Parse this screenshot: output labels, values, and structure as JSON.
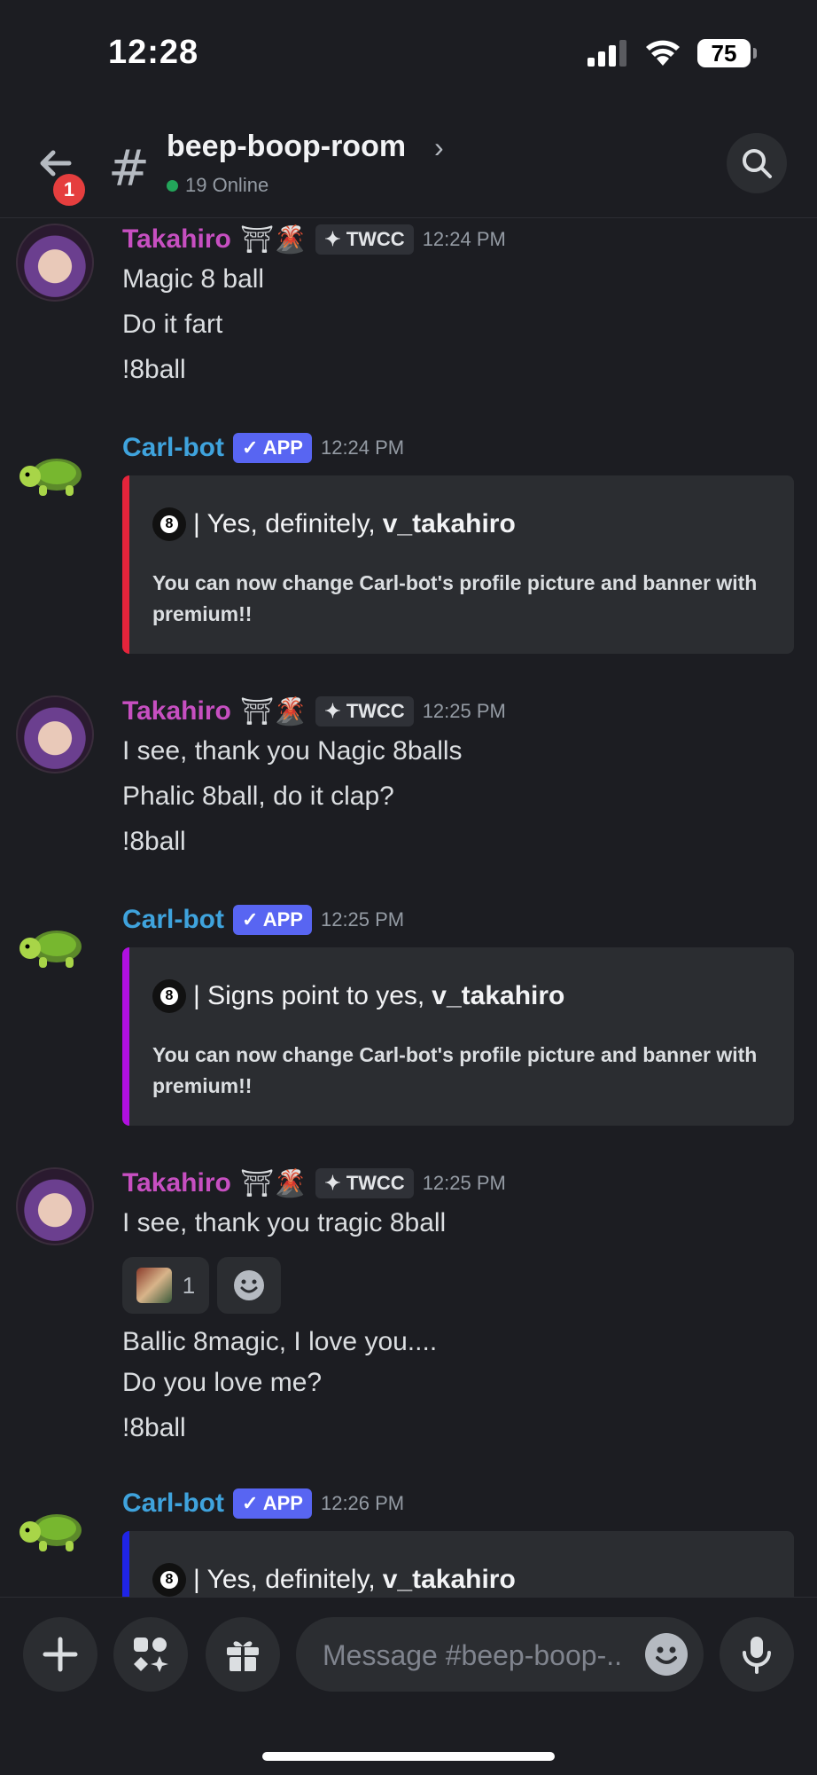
{
  "status_bar": {
    "time": "12:28",
    "battery": "75"
  },
  "header": {
    "unread_badge": "1",
    "channel_name": "beep-boop-room",
    "online_text": "19 Online"
  },
  "messages": [
    {
      "author": "Takahiro",
      "deco": "⛩🌋",
      "tag": "TWCC",
      "time": "12:24 PM",
      "lines": [
        "Magic 8 ball",
        "Do it fart",
        "!8ball"
      ]
    },
    {
      "author": "Carl-bot",
      "badge": "✓ APP",
      "time": "12:24 PM",
      "embed": {
        "color": "#e5243b",
        "text": "| Yes, definitely, ",
        "user": "v_takahiro",
        "desc": "You can now change Carl-bot's profile picture and banner with premium!!"
      }
    },
    {
      "author": "Takahiro",
      "deco": "⛩🌋",
      "tag": "TWCC",
      "time": "12:25 PM",
      "lines": [
        "I see, thank you Nagic 8balls",
        "Phalic 8ball, do it clap?",
        "!8ball"
      ]
    },
    {
      "author": "Carl-bot",
      "badge": "✓ APP",
      "time": "12:25 PM",
      "embed": {
        "color": "#b010e0",
        "text": "| Signs point to yes, ",
        "user": "v_takahiro",
        "desc": "You can now change Carl-bot's profile picture and banner with premium!!"
      }
    },
    {
      "author": "Takahiro",
      "deco": "⛩🌋",
      "tag": "TWCC",
      "time": "12:25 PM",
      "lines": [
        "I see, thank you tragic 8ball"
      ],
      "reaction_count": "1",
      "lines2": [
        "Ballic 8magic, I love you....",
        "Do you love me?",
        "!8ball"
      ]
    },
    {
      "author": "Carl-bot",
      "badge": "✓ APP",
      "time": "12:26 PM",
      "embed": {
        "color": "#1f24e6",
        "text": "| Yes, definitely, ",
        "user": "v_takahiro"
      }
    }
  ],
  "composer": {
    "placeholder": "Message #beep-boop-..."
  },
  "colors": {
    "user_name": "#c74fc1",
    "bot_name": "#3fa3dd",
    "app_badge": "#5865f2"
  }
}
